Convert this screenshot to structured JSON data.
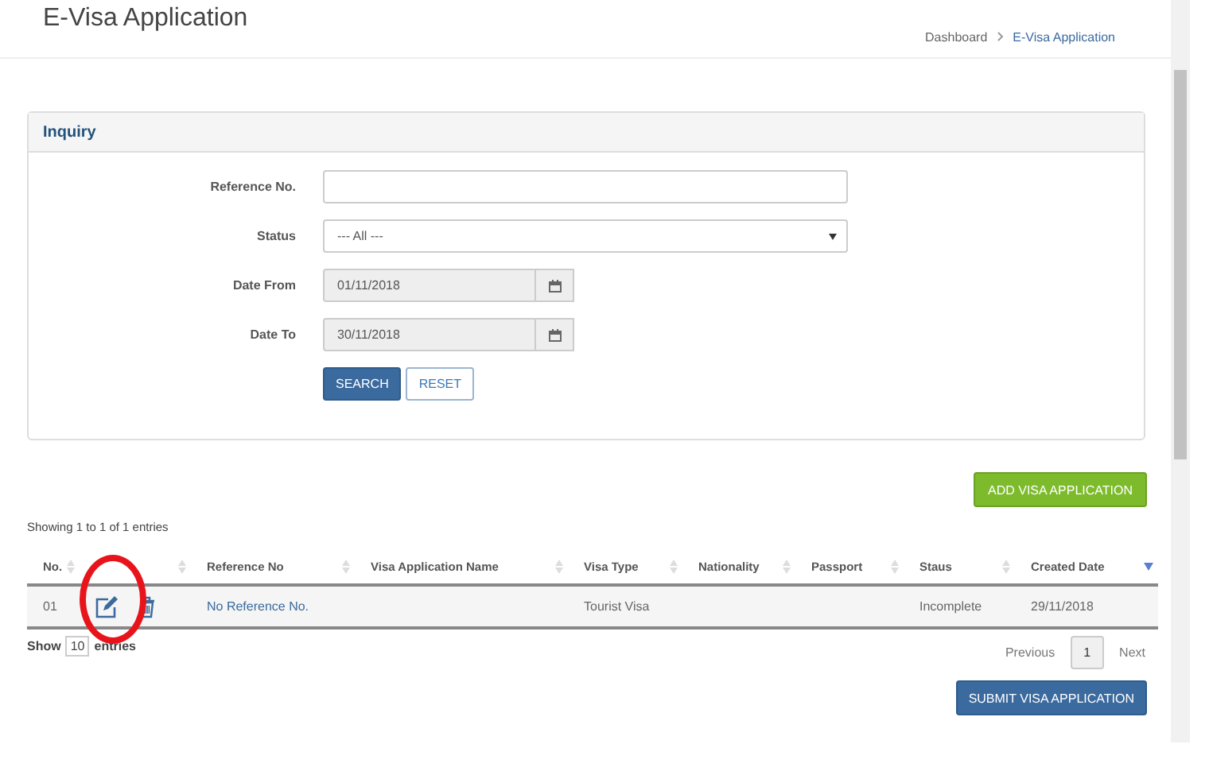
{
  "page_title": "E-Visa Application",
  "breadcrumb": [
    {
      "label": "Dashboard",
      "current": false
    },
    {
      "label": "E-Visa Application",
      "current": true
    }
  ],
  "inquiry": {
    "title": "Inquiry",
    "fields": [
      {
        "kind": "text",
        "label": "Reference No."
      },
      {
        "kind": "select",
        "label": "Status",
        "value": "--- All ---"
      },
      {
        "kind": "date",
        "label": "Date From",
        "value": "01/11/2018",
        "disabled": true
      },
      {
        "kind": "date",
        "label": "Date To",
        "value": "30/11/2018",
        "disabled": true
      }
    ],
    "buttons": [
      {
        "label": "SEARCH",
        "kind": "primary"
      },
      {
        "label": "RESET",
        "kind": "outline"
      }
    ]
  },
  "add_button": "ADD VISA APPLICATION",
  "table": {
    "info": "Showing 1 to 1 of 1 entries",
    "columns": [
      {
        "label": "No.",
        "sorted": false
      },
      {
        "sorted": false
      },
      {
        "label": "Reference No",
        "sorted": false
      },
      {
        "label": "Visa Application Name",
        "sorted": false
      },
      {
        "label": "Visa Type",
        "sorted": false
      },
      {
        "label": "Nationality",
        "sorted": false
      },
      {
        "label": "Passport",
        "sorted": false
      },
      {
        "label": "Staus",
        "sorted": false
      },
      {
        "label": "Created Date",
        "sorted": true
      }
    ],
    "rows": [
      {
        "no": "01",
        "reference_no": "No Reference No.",
        "visa_type": "Tourist Visa",
        "status": "Incomplete",
        "created_date": "29/11/2018",
        "highlighted_edit": true
      }
    ],
    "length": {
      "before": "Show",
      "value": "10",
      "after": "entries"
    },
    "pagination": {
      "previous": "Previous",
      "pages": [
        {
          "label": "1",
          "selected": true
        }
      ],
      "next": "Next"
    }
  },
  "submit_button": "SUBMIT VISA APPLICATION"
}
